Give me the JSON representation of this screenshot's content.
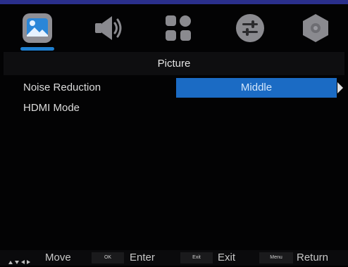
{
  "menu": {
    "title": "Picture",
    "tabs": [
      {
        "name": "picture",
        "active": true
      },
      {
        "name": "sound",
        "active": false
      },
      {
        "name": "channel",
        "active": false
      },
      {
        "name": "settings",
        "active": false
      },
      {
        "name": "lock",
        "active": false
      }
    ],
    "items": [
      {
        "label": "Noise Reduction",
        "value": "Middle"
      },
      {
        "label": "HDMI Mode"
      }
    ]
  },
  "footer": {
    "move_label": "Move",
    "ok_key": "OK",
    "enter_label": "Enter",
    "exit_key": "Exit",
    "exit_label": "Exit",
    "menu_key": "Menu",
    "return_label": "Return"
  },
  "colors": {
    "accent": "#1b6bc4",
    "underline": "#1e7fd0",
    "top_line": "#2a2f8c"
  }
}
